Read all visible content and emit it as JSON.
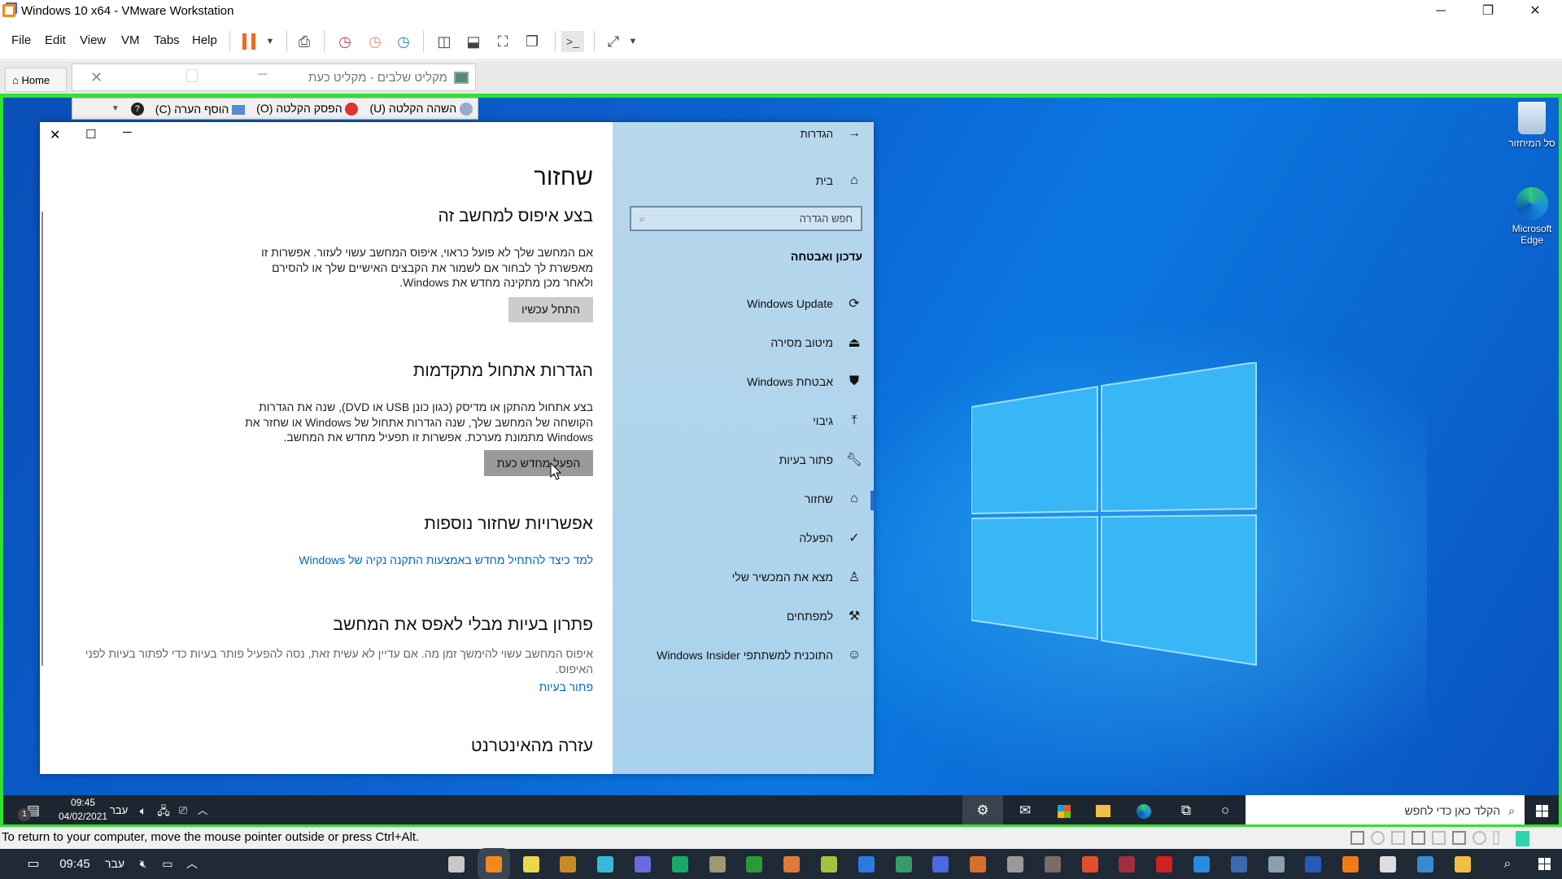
{
  "window": {
    "title": "Windows 10 x64 - VMware Workstation",
    "minimize": "─",
    "restore": "❐",
    "close": "✕"
  },
  "menu": [
    "File",
    "Edit",
    "View",
    "VM",
    "Tabs",
    "Help"
  ],
  "tabs": {
    "home": "Home",
    "recorder_title": "מקליט שלבים - מקליט כעת",
    "recorder_close": "✕",
    "recorder_min": "─"
  },
  "recorder": {
    "pause": "השהה הקלטה (U)",
    "stop": "הפסק הקלטה (O)",
    "comment": "הוסף הערה (C)",
    "help": "?"
  },
  "desktop": {
    "recycle_bin": "סל המיחזור",
    "edge": "Microsoft Edge"
  },
  "settings": {
    "controls": {
      "close": "✕",
      "maximize": "☐",
      "minimize": "─"
    },
    "nav": {
      "back_title": "הגדרות",
      "home": "בית",
      "search_placeholder": "חפש הגדרה",
      "section": "עדכון ואבטחה",
      "items": [
        {
          "label": "Windows Update",
          "icon": "refresh-icon"
        },
        {
          "label": "מיטוב מסירה",
          "icon": "delivery-icon"
        },
        {
          "label": "אבטחת Windows",
          "icon": "shield-icon"
        },
        {
          "label": "גיבוי",
          "icon": "backup-arrow-icon"
        },
        {
          "label": "פתור בעיות",
          "icon": "wrench-icon"
        },
        {
          "label": "שחזור",
          "icon": "recovery-icon",
          "selected": true
        },
        {
          "label": "הפעלה",
          "icon": "check-circle-icon"
        },
        {
          "label": "מצא את המכשיר שלי",
          "icon": "find-device-icon"
        },
        {
          "label": "למפתחים",
          "icon": "developer-tools-icon"
        },
        {
          "label": "התוכנית למשתתפי Windows Insider",
          "icon": "insider-cat-icon"
        }
      ]
    },
    "page_title": "שחזור",
    "reset": {
      "heading": "בצע איפוס למחשב זה",
      "lines": [
        "אם המחשב שלך לא פועל כראוי, איפוס המחשב עשוי לעזור. אפשרות זו",
        "מאפשרת לך לבחור אם לשמור את הקבצים האישיים שלך או להסירם",
        "ולאחר מכן מתקינה מחדש את Windows."
      ],
      "button": "התחל עכשיו"
    },
    "advanced": {
      "heading": "הגדרות אתחול מתקדמות",
      "lines": [
        "בצע אתחול מהתקן או מדיסק (כגון כונן USB או DVD), שנה את הגדרות",
        "הקושחה של המחשב שלך, שנה הגדרות אתחול של Windows או שחזר את",
        "Windows מתמונת מערכת. אפשרות זו תפעיל מחדש את המחשב."
      ],
      "button": "הפעל מחדש כעת"
    },
    "more": {
      "heading": "אפשרויות שחזור נוספות",
      "link": "למד כיצד להתחיל מחדש באמצעות התקנה נקיה של Windows"
    },
    "fix": {
      "heading": "פתרון בעיות מבלי לאפס את המחשב",
      "lines": [
        "איפוס המחשב עשוי להימשך זמן מה. אם עדיין לא עשית זאת, נסה להפעיל פותר בעיות כדי לפתור בעיות לפני",
        "האיפוס."
      ],
      "link": "פתור בעיות"
    },
    "web": {
      "heading": "עזרה מהאינטרנט"
    }
  },
  "guest_taskbar": {
    "search_placeholder": "הקלד כאן כדי לחפש",
    "time": "09:45",
    "date": "04/02/2021",
    "lang": "עבר",
    "notif_count": "1"
  },
  "status_bar": "To return to your computer, move the mouse pointer outside or press Ctrl+Alt.",
  "host_taskbar": {
    "time": "09:45",
    "lang": "עבר",
    "apps": [
      {
        "name": "steps-recorder",
        "color": "#c8c8c8"
      },
      {
        "name": "vmware",
        "color": "#f08a1c"
      },
      {
        "name": "app-yellow",
        "color": "#e8d84a"
      },
      {
        "name": "app-book",
        "color": "#c98a2a"
      },
      {
        "name": "app-cyan",
        "color": "#3ab8d8"
      },
      {
        "name": "app-purple",
        "color": "#6a6ae0"
      },
      {
        "name": "app-green-u",
        "color": "#1aa86a"
      },
      {
        "name": "app-paint",
        "color": "#9a9a70"
      },
      {
        "name": "app-green",
        "color": "#2a9a3a"
      },
      {
        "name": "app-orange",
        "color": "#e07a3a"
      },
      {
        "name": "app-leaf",
        "color": "#a8c040"
      },
      {
        "name": "app-store",
        "color": "#2a7ae0"
      },
      {
        "name": "app-globe",
        "color": "#3a9a6a"
      },
      {
        "name": "app-blue",
        "color": "#4a6ae0"
      },
      {
        "name": "app-photo",
        "color": "#d8702a"
      },
      {
        "name": "app-usb",
        "color": "#9a9a9a"
      },
      {
        "name": "app-clock",
        "color": "#7a6a6a"
      },
      {
        "name": "app-maps",
        "color": "#e0502a"
      },
      {
        "name": "app-red-book",
        "color": "#a03040"
      },
      {
        "name": "acrobat",
        "color": "#d02020"
      },
      {
        "name": "app-compass",
        "color": "#2a8ae0"
      },
      {
        "name": "app-pc",
        "color": "#3a6ab0"
      },
      {
        "name": "app-monitor",
        "color": "#8aa0b0"
      },
      {
        "name": "word",
        "color": "#2a5ab8"
      },
      {
        "name": "app-search",
        "color": "#f07a1a"
      },
      {
        "name": "settings",
        "color": "#dddddd"
      },
      {
        "name": "app-news",
        "color": "#3a8ad0"
      },
      {
        "name": "file-explorer",
        "color": "#f0c040"
      }
    ]
  }
}
